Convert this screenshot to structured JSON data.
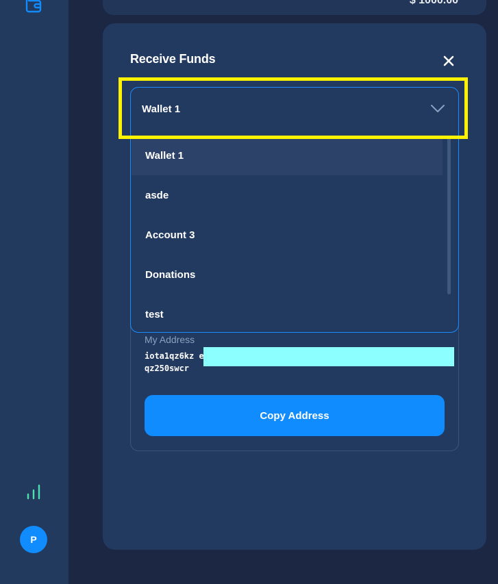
{
  "sidebar": {
    "wallet_icon": "wallet-icon",
    "activity_icon": "bar-chart-icon",
    "avatar_initial": "P"
  },
  "header": {
    "balance_partial": "$ 1000.00"
  },
  "modal": {
    "title": "Receive Funds",
    "close_icon": "close-icon",
    "dropdown": {
      "selected": "Wallet 1",
      "options": [
        "Wallet 1",
        "asde",
        "Account 3",
        "Donations",
        "test"
      ],
      "active_index": 0
    },
    "address": {
      "label": "My Address",
      "value": "iota1qz6kz e6qz250swcr"
    },
    "copy_button_label": "Copy Address"
  },
  "colors": {
    "accent": "#118cff",
    "highlight": "#fff200",
    "redaction": "#8cffff",
    "panel": "#233a60",
    "background": "#1b2743"
  }
}
